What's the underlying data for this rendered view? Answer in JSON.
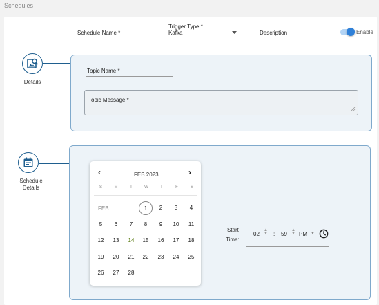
{
  "header": {
    "title": "Schedules"
  },
  "top_fields": {
    "schedule_name": {
      "label": "Schedule Name *",
      "value": ""
    },
    "trigger_type": {
      "label": "Trigger Type *",
      "value": "Kafka"
    },
    "description": {
      "label": "Description",
      "value": ""
    },
    "enable": {
      "label": "Enable",
      "checked": true
    }
  },
  "steps": {
    "details": {
      "label": "Details",
      "icon": "image-search-icon"
    },
    "schedule_details": {
      "label_line1": "Schedule",
      "label_line2": "Details",
      "icon": "calendar-icon"
    }
  },
  "details_panel": {
    "topic_name": {
      "label": "Topic Name *",
      "value": ""
    },
    "topic_message": {
      "label": "Topic Message *",
      "value": ""
    }
  },
  "calendar": {
    "prev_label": "‹",
    "next_label": "›",
    "title": "FEB 2023",
    "weekdays": [
      "S",
      "M",
      "T",
      "W",
      "T",
      "F",
      "S"
    ],
    "month_label": "FEB",
    "selected_day": "1",
    "days": [
      "1",
      "2",
      "3",
      "4",
      "5",
      "6",
      "7",
      "8",
      "9",
      "10",
      "11",
      "12",
      "13",
      "14",
      "15",
      "16",
      "17",
      "18",
      "19",
      "20",
      "21",
      "22",
      "23",
      "24",
      "25",
      "26",
      "27",
      "28"
    ],
    "highlighted_days": [
      "14"
    ]
  },
  "start_time": {
    "label_line1": "Start",
    "label_line2": "Time:",
    "hour": "02",
    "separator": ":",
    "minute": "59",
    "ampm": "PM"
  },
  "colors": {
    "accent": "#2f80d8",
    "stepper": "#1f5f8f",
    "panel_bg": "#edf3f8",
    "panel_border": "#7fa9cc"
  }
}
